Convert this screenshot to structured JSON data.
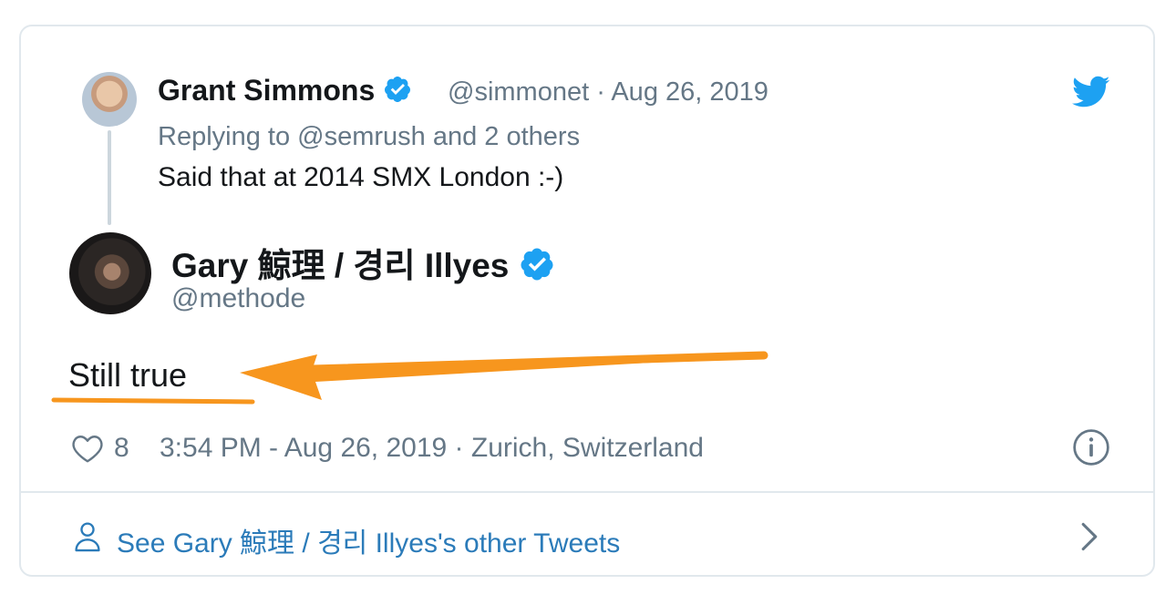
{
  "tweet_parent": {
    "author_name": "Grant Simmons",
    "author_handle": "@simmonet",
    "separator": "·",
    "date": "Aug 26, 2019",
    "replying_to": "Replying to @semrush and 2 others",
    "text": "Said that at 2014 SMX London :-)"
  },
  "tweet_main": {
    "author_name": "Gary 鯨理 / 경리 Illyes",
    "author_handle": "@methode",
    "text": "Still true",
    "likes": "8",
    "timestamp": "3:54 PM - Aug 26, 2019 · Zurich, Switzerland"
  },
  "footer": {
    "see_other_tweets": "See Gary 鯨理 / 경리 Illyes's other Tweets"
  },
  "colors": {
    "verified": "#1da1f2",
    "twitter_blue": "#1da1f2",
    "link": "#2b7bb9",
    "muted": "#657786",
    "annotation_orange": "#f7961e"
  },
  "icons": [
    "twitter-bird-icon",
    "verified-badge-icon",
    "heart-icon",
    "info-icon",
    "person-icon",
    "chevron-right-icon"
  ]
}
